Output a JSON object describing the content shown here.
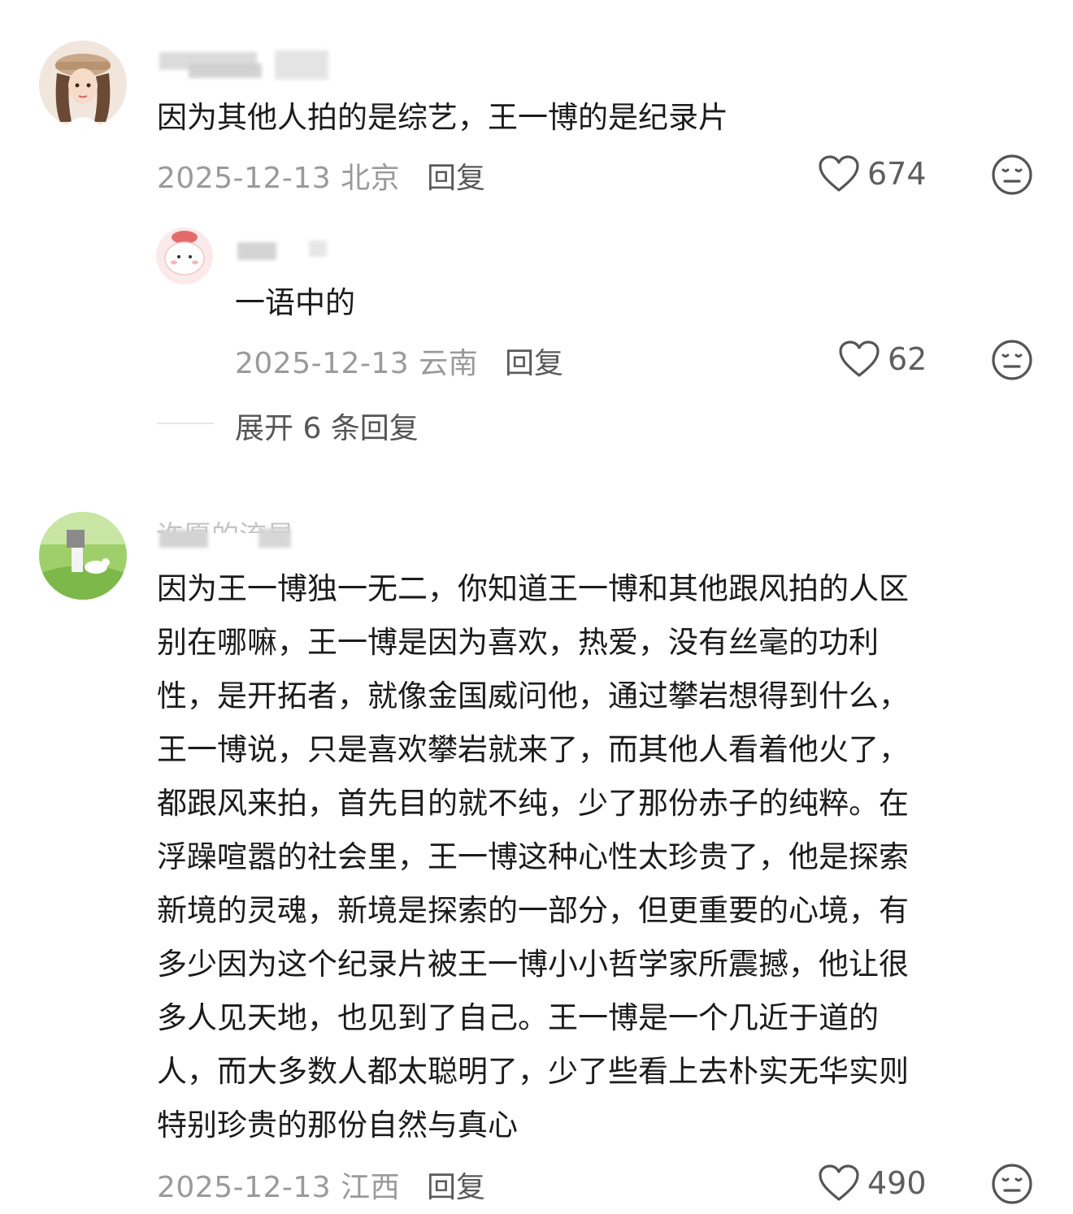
{
  "comments": [
    {
      "content": "因为其他人拍的是综艺，王一博的是纪录片",
      "date": "2025-12-13",
      "location": "北京",
      "reply_label": "回复",
      "likes": "674",
      "like_icon": "heart-outline-icon",
      "dislike_icon": "neutral-face-icon",
      "replies": [
        {
          "content": "一语中的",
          "date": "2025-12-13",
          "location": "云南",
          "reply_label": "回复",
          "likes": "62"
        }
      ],
      "expand_label": "展开 6 条回复"
    },
    {
      "username_partial": "许愿的流星",
      "content": "因为王一博独一无二，你知道王一博和其他跟风拍的人区\n别在哪嘛，王一博是因为喜欢，热爱，没有丝毫的功利\n性，是开拓者，就像金国威问他，通过攀岩想得到什么，\n王一博说，只是喜欢攀岩就来了，而其他人看着他火了，\n都跟风来拍，首先目的就不纯，少了那份赤子的纯粹。在\n浮躁喧嚣的社会里，王一博这种心性太珍贵了，他是探索\n新境的灵魂，新境是探索的一部分，但更重要的心境，有\n多少因为这个纪录片被王一博小小哲学家所震撼，他让很\n多人见天地，也见到了自己。王一博是一个几近于道的\n人，而大多数人都太聪明了，少了些看上去朴实无华实则\n特别珍贵的那份自然与真心",
      "date": "2025-12-13",
      "location": "江西",
      "reply_label": "回复",
      "likes": "490"
    }
  ],
  "colors": {
    "text": "#1b1b1b",
    "meta": "#9a9a9a",
    "icon": "#555555"
  }
}
